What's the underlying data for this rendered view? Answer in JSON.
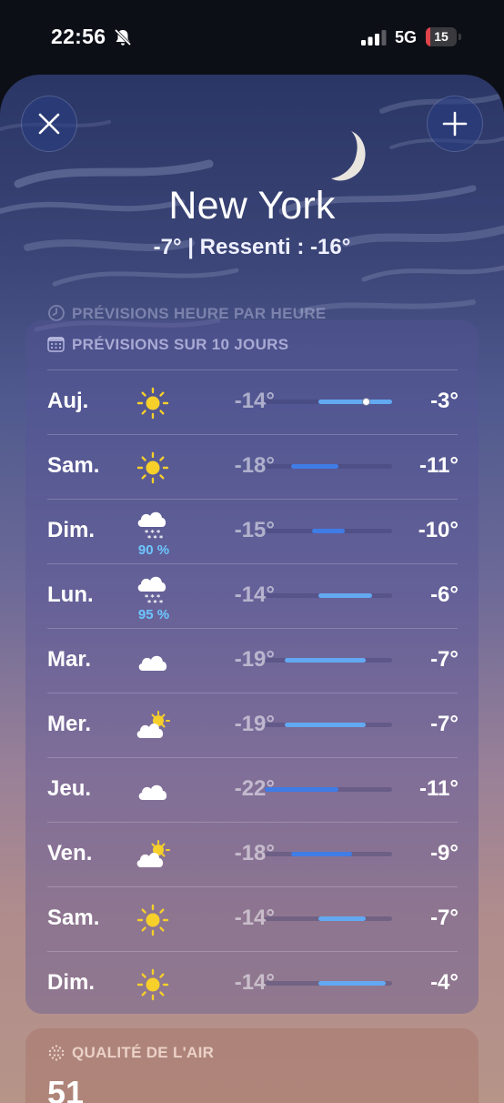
{
  "status_bar": {
    "time": "22:56",
    "network": "5G",
    "battery": "15",
    "battery_level": 0.15,
    "battery_color": "#e0444a",
    "icons": [
      "bell-slash-icon",
      "signal-bars-icon",
      "battery-icon"
    ]
  },
  "header": {
    "close_icon": "close-icon",
    "add_icon": "plus-icon",
    "city": "New York",
    "temperature_line": "-7°  |  Ressenti : -16°"
  },
  "hourly": {
    "title": "PRÉVISIONS HEURE PAR HEURE",
    "icon": "clock-icon"
  },
  "forecast": {
    "title": "PRÉVISIONS SUR 10 JOURS",
    "icon": "calendar-icon",
    "scale_min": -22,
    "scale_max": -3,
    "current_temp": -7,
    "days": [
      {
        "day": "Auj.",
        "icon": "sun-icon",
        "low": "-14°",
        "high": "-3°",
        "low_val": -14,
        "high_val": -3,
        "precip": ""
      },
      {
        "day": "Sam.",
        "icon": "sun-icon",
        "low": "-18°",
        "high": "-11°",
        "low_val": -18,
        "high_val": -11,
        "precip": ""
      },
      {
        "day": "Dim.",
        "icon": "snow-cloud-icon",
        "low": "-15°",
        "high": "-10°",
        "low_val": -15,
        "high_val": -10,
        "precip": "90 %"
      },
      {
        "day": "Lun.",
        "icon": "snow-cloud-icon",
        "low": "-14°",
        "high": "-6°",
        "low_val": -14,
        "high_val": -6,
        "precip": "95 %"
      },
      {
        "day": "Mar.",
        "icon": "cloud-icon",
        "low": "-19°",
        "high": "-7°",
        "low_val": -19,
        "high_val": -7,
        "precip": ""
      },
      {
        "day": "Mer.",
        "icon": "partly-cloudy-icon",
        "low": "-19°",
        "high": "-7°",
        "low_val": -19,
        "high_val": -7,
        "precip": ""
      },
      {
        "day": "Jeu.",
        "icon": "cloud-icon",
        "low": "-22°",
        "high": "-11°",
        "low_val": -22,
        "high_val": -11,
        "precip": ""
      },
      {
        "day": "Ven.",
        "icon": "partly-cloudy-icon",
        "low": "-18°",
        "high": "-9°",
        "low_val": -18,
        "high_val": -9,
        "precip": ""
      },
      {
        "day": "Sam.",
        "icon": "sun-icon",
        "low": "-14°",
        "high": "-7°",
        "low_val": -14,
        "high_val": -7,
        "precip": ""
      },
      {
        "day": "Dim.",
        "icon": "sun-icon",
        "low": "-14°",
        "high": "-4°",
        "low_val": -14,
        "high_val": -4,
        "precip": ""
      }
    ]
  },
  "air_quality": {
    "title": "QUALITÉ DE L'AIR",
    "icon": "air-quality-icon",
    "value": "51"
  },
  "colors": {
    "range_cold": "#3f7ce6",
    "range_mild": "#62a9f2",
    "precip": "#6cc6ff"
  }
}
